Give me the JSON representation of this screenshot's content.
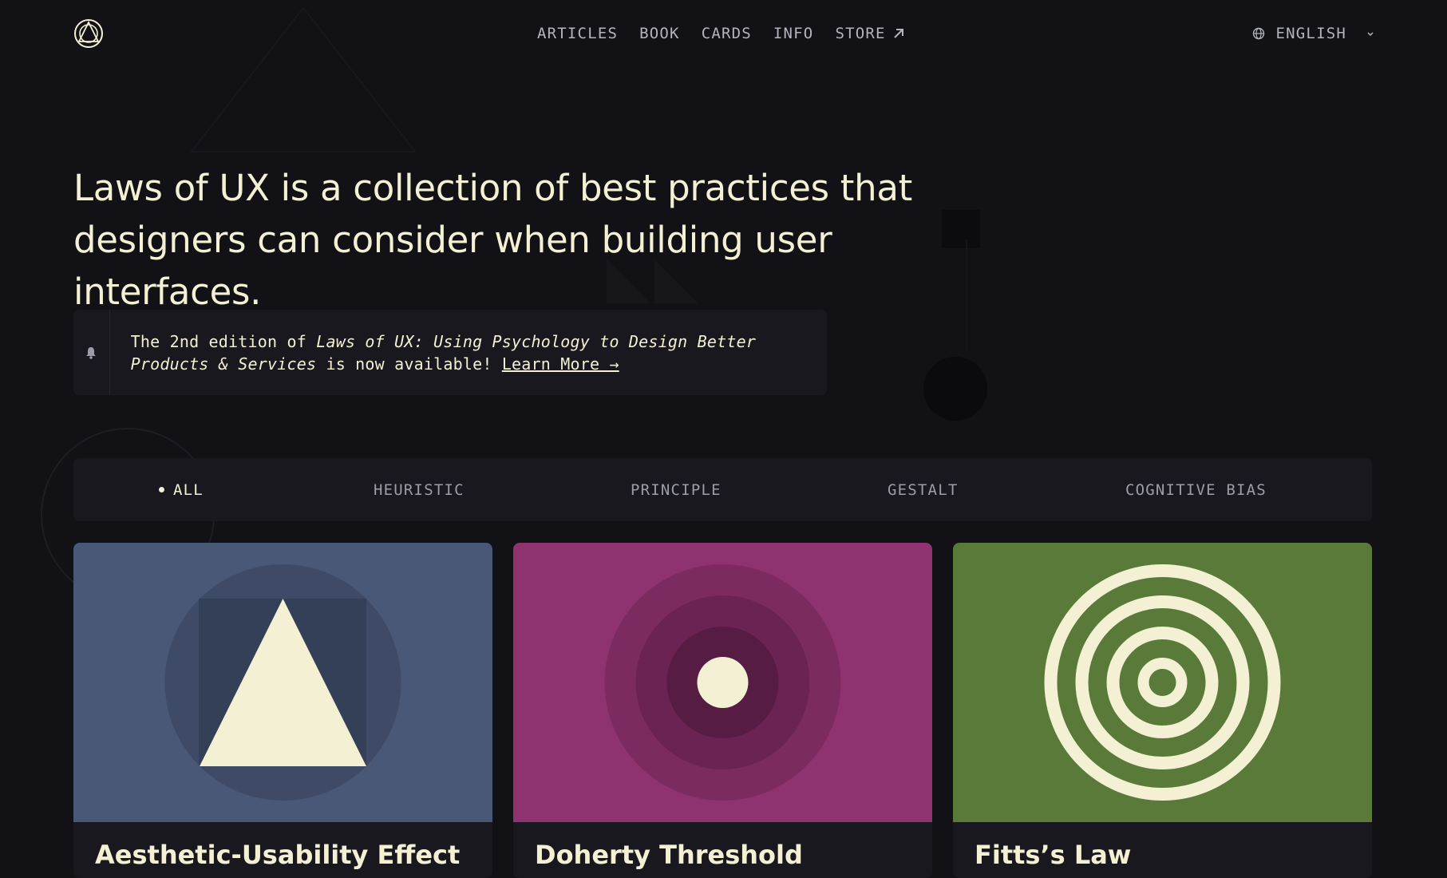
{
  "colors": {
    "background": "#111116",
    "surface": "#18181e",
    "text": "#f3f0d4",
    "muted": "#b3b4bd"
  },
  "header": {
    "logo_icon": "laws-of-ux-logo-icon",
    "nav": [
      {
        "label": "ARTICLES"
      },
      {
        "label": "BOOK"
      },
      {
        "label": "CARDS"
      },
      {
        "label": "INFO"
      },
      {
        "label": "STORE",
        "icon": "external-arrow-icon"
      }
    ],
    "language": {
      "label": "ENGLISH",
      "icon": "globe-icon"
    }
  },
  "hero": {
    "line1": "Laws of UX is a collection of best practices that",
    "line2": "designers can consider when building user interfaces."
  },
  "announcement": {
    "icon": "bell-icon",
    "text_before": "The 2nd edition of ",
    "book_title": "Laws of UX: Using Psychology to Design Better Products & Services",
    "text_after": " is now available! ",
    "link": "Learn More →"
  },
  "filters": [
    {
      "label": "ALL",
      "active": true
    },
    {
      "label": "HEURISTIC",
      "active": false
    },
    {
      "label": "PRINCIPLE",
      "active": false
    },
    {
      "label": "GESTALT",
      "active": false
    },
    {
      "label": "COGNITIVE BIAS",
      "active": false
    }
  ],
  "cards": [
    {
      "title": "Aesthetic-Usability Effect",
      "bg": "#4a5877",
      "icon": "triangle-in-circle-icon"
    },
    {
      "title": "Doherty Threshold",
      "bg": "#8e3270",
      "icon": "concentric-dot-icon"
    },
    {
      "title": "Fitts’s Law",
      "bg": "#5a7a3a",
      "icon": "target-rings-icon"
    }
  ]
}
